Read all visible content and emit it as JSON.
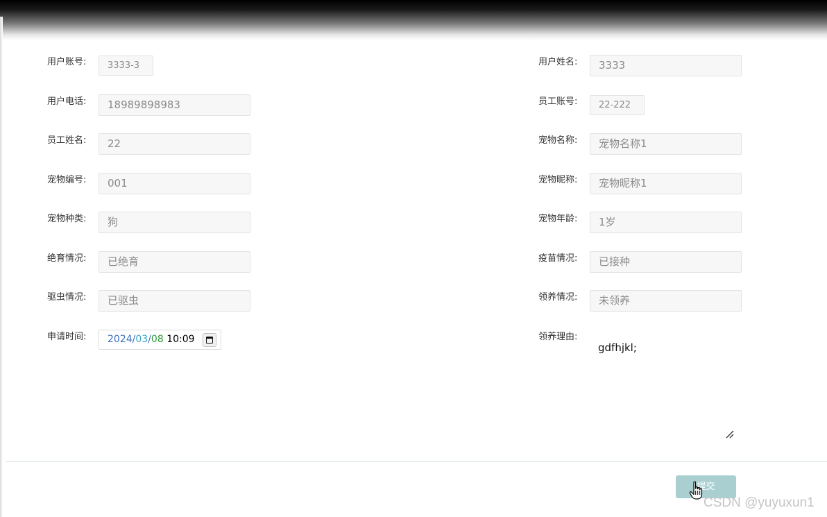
{
  "form": {
    "left": [
      {
        "label": "用户账号:",
        "value": "3333-3"
      },
      {
        "label": "用户电话:",
        "value": "18989898983"
      },
      {
        "label": "员工姓名:",
        "value": "22"
      },
      {
        "label": "宠物编号:",
        "value": "001"
      },
      {
        "label": "宠物种类:",
        "value": "狗"
      },
      {
        "label": "绝育情况:",
        "value": "已绝育"
      },
      {
        "label": "驱虫情况:",
        "value": "已驱虫"
      },
      {
        "label": "申请时间:",
        "date_year": "2024",
        "date_month": "03",
        "date_day": "08",
        "time": "10:09",
        "sep": "/"
      }
    ],
    "right": [
      {
        "label": "用户姓名:",
        "value": "3333"
      },
      {
        "label": "员工账号:",
        "value": "22-222"
      },
      {
        "label": "宠物名称:",
        "value": "宠物名称1"
      },
      {
        "label": "宠物昵称:",
        "value": "宠物昵称1"
      },
      {
        "label": "宠物年龄:",
        "value": "1岁"
      },
      {
        "label": "疫苗情况:",
        "value": "已接种"
      },
      {
        "label": "领养情况:",
        "value": "未领养"
      },
      {
        "label": "领养理由:",
        "value": "gdfhjkl;"
      }
    ]
  },
  "actions": {
    "submit_label": "提交"
  },
  "watermark": "CSDN @yuyuxun1",
  "colors": {
    "submit_bg": "#aacfd1",
    "field_bg": "#f7f7f7",
    "divider": "#cfdcdf"
  }
}
